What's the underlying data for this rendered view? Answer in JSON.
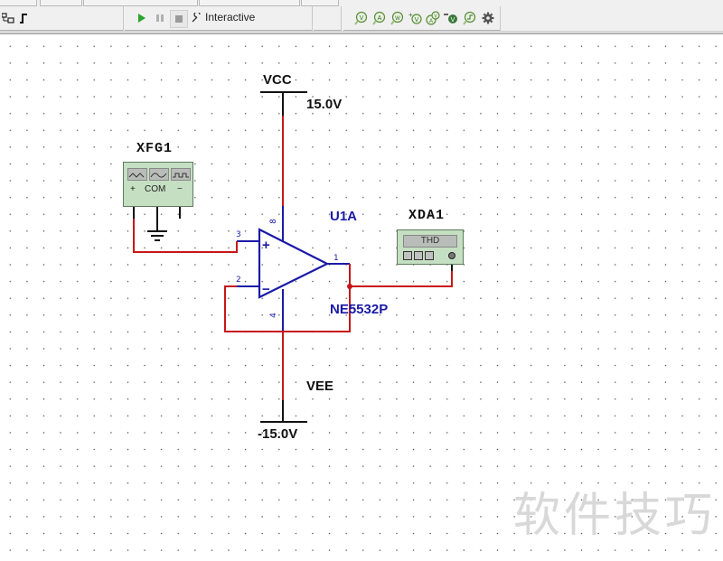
{
  "toolbar": {
    "left_icons": [
      "component-connector-icon",
      "step-signal-icon"
    ],
    "simulation": {
      "run_icon": "play-icon",
      "pause_icon": "pause-icon",
      "stop_icon": "stop-icon",
      "mode_icon": "wrench-icon",
      "mode_label": "Interactive"
    },
    "probe_icons": [
      "voltage-probe-icon",
      "current-probe-icon",
      "power-probe-icon",
      "differential-voltage-probe-icon",
      "voltage-current-probe-icon",
      "reference-probe-icon",
      "digital-probe-icon",
      "probe-settings-gear-icon"
    ],
    "probe_glyphs": [
      "V",
      "A",
      "W",
      "±V",
      "AV",
      "-V",
      "⏚",
      "⚙"
    ]
  },
  "schematic": {
    "vcc": {
      "name": "VCC",
      "value": "15.0V"
    },
    "vee": {
      "name": "VEE",
      "value": "-15.0V"
    },
    "function_generator": {
      "ref": "XFG1",
      "terminals": [
        "+",
        "COM",
        "−"
      ],
      "waveforms": [
        "triangle",
        "sine",
        "square"
      ]
    },
    "opamp": {
      "ref": "U1A",
      "part": "NE5532P",
      "pins": {
        "noninv": "3",
        "inv": "2",
        "out": "1",
        "vplus": "8",
        "vminus": "4"
      },
      "noninv_symbol": "+",
      "inv_symbol": "−"
    },
    "distortion_analyzer": {
      "ref": "XDA1",
      "display": "THD"
    },
    "colors": {
      "wire": "#c8161b",
      "component": "#1a1aa6",
      "power": "#111111",
      "instrument_bg": "#c5dfc2"
    }
  },
  "watermark": "软件技巧"
}
